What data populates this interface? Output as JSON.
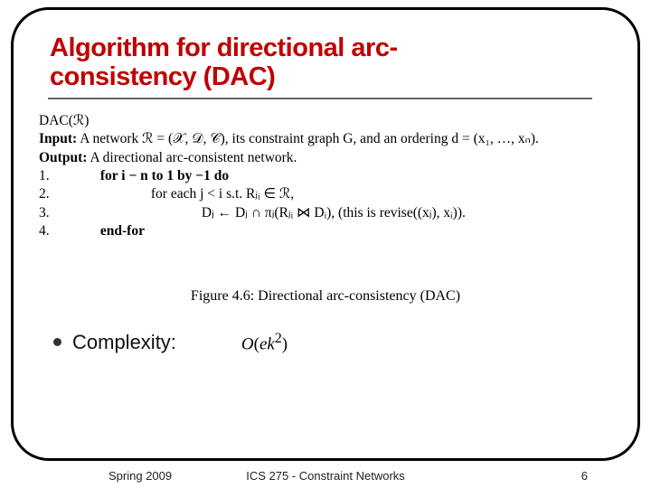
{
  "title_line1": "Algorithm for directional arc-",
  "title_line2": "consistency (DAC)",
  "algo": {
    "name": "DAC(ℛ)",
    "input_label": "Input:",
    "input_text": "A network ℛ = (𝒳, 𝒟, 𝒞), its constraint graph G, and an ordering d = (x₁, …, xₙ).",
    "output_label": "Output:",
    "output_text": "A directional arc-consistent network.",
    "lines": [
      {
        "n": "1.",
        "text": "for i − n to 1 by −1 do",
        "bold": true,
        "indent": 1
      },
      {
        "n": "2.",
        "text": "for each  j < i  s.t.  Rⱼᵢ ∈ ℛ,",
        "bold": false,
        "indent": 2
      },
      {
        "n": "3.",
        "text": "Dⱼ ← Dⱼ ∩ πⱼ(Rⱼᵢ ⋈ Dᵢ),   (this is revise((xⱼ), xᵢ)).",
        "bold": false,
        "indent": 3
      },
      {
        "n": "4.",
        "text": "end-for",
        "bold": true,
        "indent": 1
      }
    ]
  },
  "caption": "Figure 4.6: Directional arc-consistency (DAC)",
  "complexity_label": "Complexity:",
  "complexity_formula": "O(ek²)",
  "footer": {
    "left": "Spring 2009",
    "center": "ICS 275 - Constraint Networks",
    "right": "6"
  }
}
